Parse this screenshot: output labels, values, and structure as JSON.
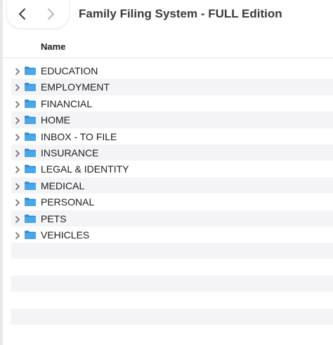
{
  "window": {
    "title": "Family Filing System - FULL Edition"
  },
  "toolbar": {
    "back_icon": "chevron-left-icon",
    "forward_icon": "chevron-right-icon"
  },
  "column_header": {
    "name_label": "Name"
  },
  "folders": [
    {
      "label": "EDUCATION"
    },
    {
      "label": "EMPLOYMENT"
    },
    {
      "label": "FINANCIAL"
    },
    {
      "label": "HOME"
    },
    {
      "label": "INBOX - TO FILE"
    },
    {
      "label": "INSURANCE"
    },
    {
      "label": "LEGAL & IDENTITY"
    },
    {
      "label": "MEDICAL"
    },
    {
      "label": "PERSONAL"
    },
    {
      "label": "PETS"
    },
    {
      "label": "VEHICLES"
    }
  ],
  "colors": {
    "folder_blue": "#4aa8e8",
    "folder_blue_dark": "#2f8fd6",
    "stripe": "#f4f4f6"
  }
}
